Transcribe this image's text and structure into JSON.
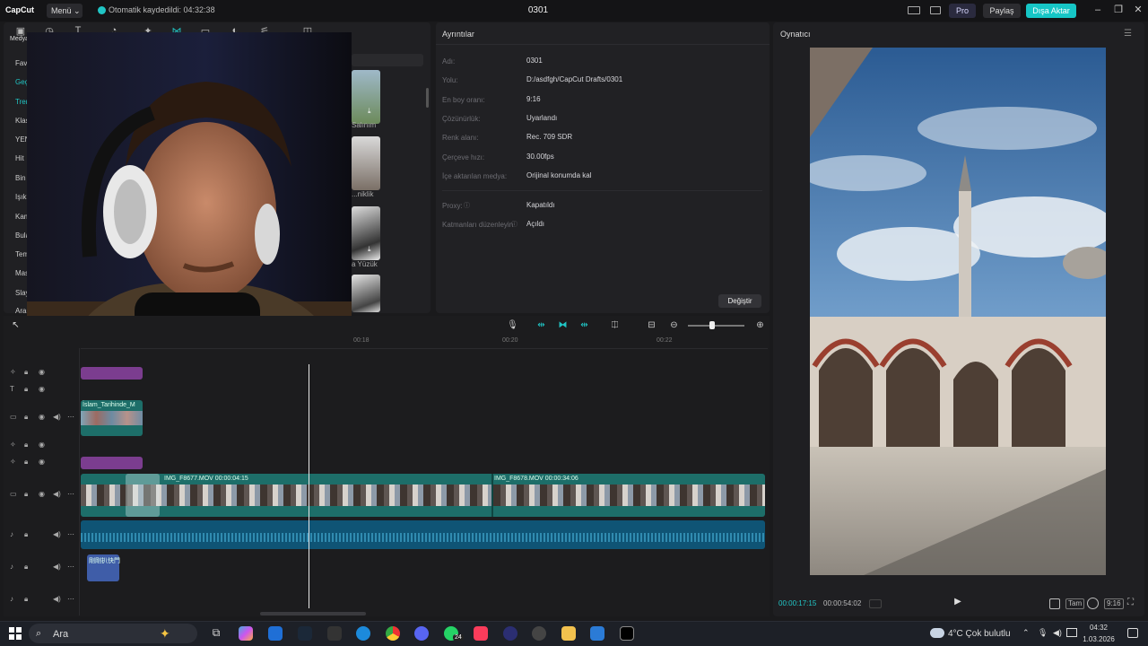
{
  "titlebar": {
    "logo": "CapCut",
    "menu_label": "Menü",
    "autosave": "Otomatik kaydedildi: 04:32:38",
    "project_title": "0301",
    "pro_label": "Pro",
    "share_label": "Paylaş",
    "export_label": "Dışa Aktar"
  },
  "media_panel": {
    "label": "Medya",
    "categories": [
      "Fav",
      "Geç",
      "Tren",
      "Klas",
      "YEN",
      "Hit",
      "Bin",
      "Işık",
      "Kam",
      "Bula",
      "Tem",
      "Mas",
      "Slay",
      "Ara"
    ],
    "thumb_labels": [
      "Salınım",
      "...niklik",
      "a Yüzük"
    ]
  },
  "details": {
    "title": "Ayrıntılar",
    "rows": [
      {
        "label": "Adı:",
        "value": "0301"
      },
      {
        "label": "Yolu:",
        "value": "D:/asdfgh/CapCut Drafts/0301"
      },
      {
        "label": "En boy oranı:",
        "value": "9:16"
      },
      {
        "label": "Çözünürlük:",
        "value": "Uyarlandı"
      },
      {
        "label": "Renk alanı:",
        "value": "Rec. 709 SDR"
      },
      {
        "label": "Çerçeve hızı:",
        "value": "30.00fps"
      },
      {
        "label": "İçe aktarılan medya:",
        "value": "Orijinal konumda kal"
      },
      {
        "label": "Proxy:",
        "value": "Kapatıldı"
      },
      {
        "label": "Katmanları düzenleyin",
        "value": "Açıldı"
      }
    ],
    "change_label": "Değiştir"
  },
  "player": {
    "title": "Oynatıcı",
    "current_time": "00:00:17:15",
    "total_time": "00:00:54:02",
    "full_label": "Tam",
    "ratio_label": "9:16"
  },
  "timeline": {
    "ruler": [
      "00:18",
      "00:20",
      "00:22"
    ],
    "clips": {
      "text_clip_label": "İslam_Tarihinde_M",
      "main_clip_1": "IMG_F8677.MOV  00:00:04:15",
      "main_clip_2": "IMG_F8678.MOV  00:00:34:06",
      "audio_clip": "剛剛扒快門"
    }
  },
  "taskbar": {
    "search_label": "Ara",
    "weather": "4°C  Çok bulutlu",
    "time": "04:32",
    "date": "1.03.2026",
    "whatsapp_badge": "24"
  },
  "colors": {
    "accent": "#16c6c6",
    "clip_teal": "#1d6e69",
    "clip_purple": "#7b3d8f",
    "audio_blue": "#0f5475"
  }
}
